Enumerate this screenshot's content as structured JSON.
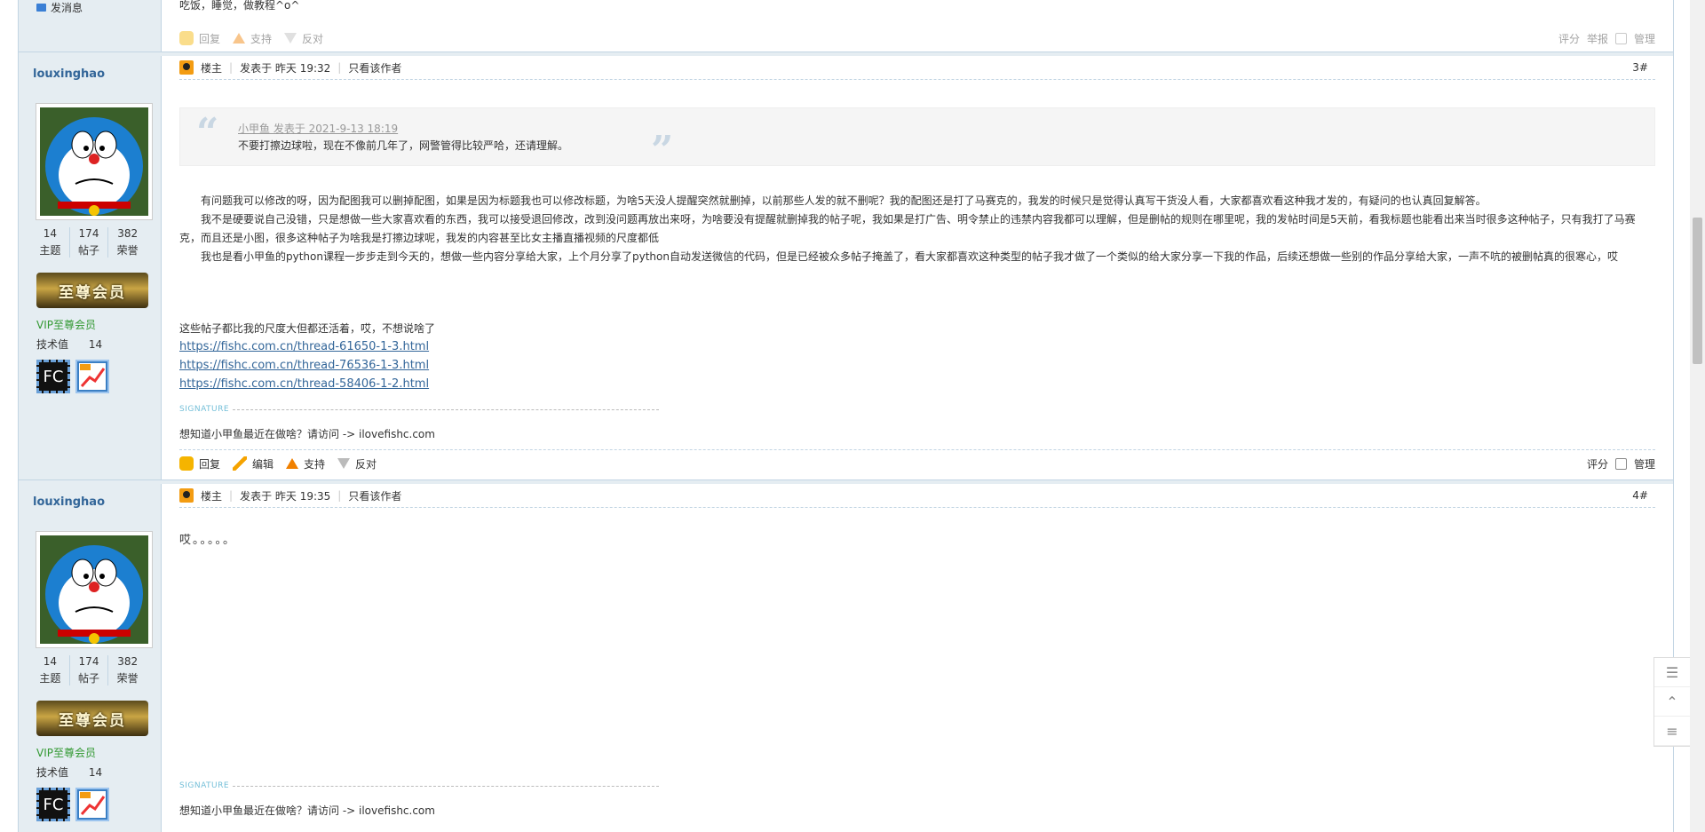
{
  "top_post": {
    "send_msg": "发消息",
    "tail_text": "吃饭，睡觉，做教程^o^",
    "actions": {
      "reply": "回复",
      "support": "支持",
      "oppose": "反对"
    },
    "right": {
      "rate": "评分",
      "report": "举报",
      "manage": "管理"
    }
  },
  "post3": {
    "author": "louxinghao",
    "stats": [
      {
        "num": "14",
        "label": "主题"
      },
      {
        "num": "174",
        "label": "帖子"
      },
      {
        "num": "382",
        "label": "荣誉"
      }
    ],
    "vip_badge": "至尊会员",
    "vip_name": "VIP至尊会员",
    "tech_label": "技术值",
    "tech_value": "14",
    "medal_fc": "FC",
    "header": {
      "owner": "楼主",
      "posted": "发表于 昨天 19:32",
      "only_author": "只看该作者",
      "floor": "3#"
    },
    "quote": {
      "by": "小甲鱼 发表于 2021-9-13 18:19",
      "text": "不要打擦边球啦，现在不像前几年了，网警管得比较严哈，还请理解。"
    },
    "paragraphs": [
      "有问题我可以修改的呀，因为配图我可以删掉配图，如果是因为标题我也可以修改标题，为啥5天没人提醒突然就删掉，以前那些人发的就不删呢？我的配图还是打了马赛克的，我发的时候只是觉得认真写干货没人看，大家都喜欢看这种我才发的，有疑问的也认真回复解答。",
      "我不是硬要说自己没错，只是想做一些大家喜欢看的东西，我可以接受退回修改，改到没问题再放出来呀，为啥要没有提醒就删掉我的帖子呢，我如果是打广告、明令禁止的违禁内容我都可以理解，但是删帖的规则在哪里呢，我的发帖时间是5天前，看我标题也能看出来当时很多这种帖子，只有我打了马赛克，而且还是小图，很多这种帖子为啥我是打擦边球呢，我发的内容甚至比女主播直播视频的尺度都低",
      "我也是看小甲鱼的python课程一步步走到今天的，想做一些内容分享给大家，上个月分享了python自动发送微信的代码，但是已经被众多帖子掩盖了，看大家都喜欢这种类型的帖子我才做了一个类似的给大家分享一下我的作品，后续还想做一些别的作品分享给大家，一声不吭的被删帖真的很寒心，哎"
    ],
    "extra_line": "这些帖子都比我的尺度大但都还活着，哎，不想说啥了",
    "links": [
      "https://fishc.com.cn/thread-61650-1-3.html",
      "https://fishc.com.cn/thread-76536-1-3.html",
      "https://fishc.com.cn/thread-58406-1-2.html"
    ],
    "signature_label": "SIGNATURE",
    "signature": "想知道小甲鱼最近在做啥？请访问 -> ilovefishc.com",
    "actions": {
      "reply": "回复",
      "edit": "编辑",
      "support": "支持",
      "oppose": "反对"
    },
    "right": {
      "rate": "评分",
      "manage": "管理"
    }
  },
  "post4": {
    "author": "louxinghao",
    "stats": [
      {
        "num": "14",
        "label": "主题"
      },
      {
        "num": "174",
        "label": "帖子"
      },
      {
        "num": "382",
        "label": "荣誉"
      }
    ],
    "vip_badge": "至尊会员",
    "vip_name": "VIP至尊会员",
    "tech_label": "技术值",
    "tech_value": "14",
    "medal_fc": "FC",
    "header": {
      "owner": "楼主",
      "posted": "发表于 昨天 19:35",
      "only_author": "只看该作者",
      "floor": "4#"
    },
    "content": "哎。。。。。",
    "signature_label": "SIGNATURE",
    "signature": "想知道小甲鱼最近在做啥？请访问 -> ilovefishc.com"
  }
}
